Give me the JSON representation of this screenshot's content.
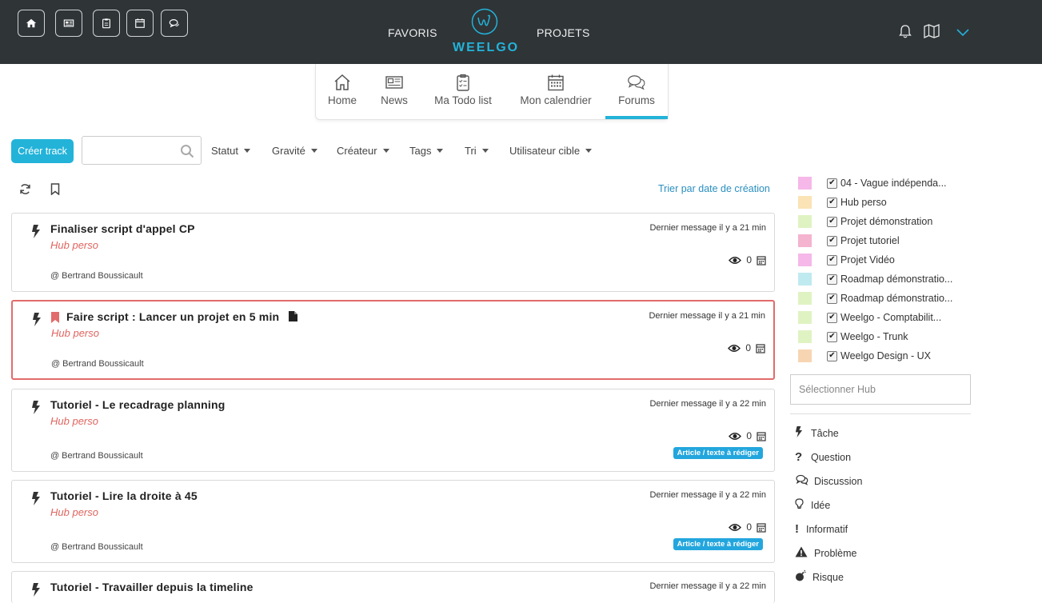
{
  "topbar": {
    "buttons": [
      "home",
      "news",
      "todo",
      "calendar",
      "chat"
    ],
    "favoris": "FAVORIS",
    "projets": "PROJETS",
    "logo": "WEELGO",
    "colors": {
      "bg": "#2f3437",
      "accent": "#23b3d9"
    }
  },
  "tabs": [
    {
      "label": "Home",
      "icon": "home-icon"
    },
    {
      "label": "News",
      "icon": "newspaper-icon"
    },
    {
      "label": "Ma Todo list",
      "icon": "checklist-icon"
    },
    {
      "label": "Mon calendrier",
      "icon": "calendar-icon"
    },
    {
      "label": "Forums",
      "icon": "comments-icon",
      "active": true
    }
  ],
  "filters": {
    "create_label": "Créer track",
    "search_value": "",
    "dropdowns": [
      "Statut",
      "Gravité",
      "Créateur",
      "Tags",
      "Tri",
      "Utilisateur cible"
    ],
    "sort_link": "Trier par date de création"
  },
  "tracks": [
    {
      "title": "Finaliser script d'appel CP",
      "hub": "Hub perso",
      "author": "Bertrand Boussicault",
      "last": "Dernier message il y a 21 min",
      "views": "0",
      "badge": ""
    },
    {
      "title": "Faire script : Lancer un projet en 5 min",
      "hub": "Hub perso",
      "author": "Bertrand Boussicault",
      "last": "Dernier message il y a 21 min",
      "views": "0",
      "badge": "",
      "bookmarked": true,
      "has_file": true
    },
    {
      "title": "Tutoriel - Le recadrage planning",
      "hub": "Hub perso",
      "author": "Bertrand Boussicault",
      "last": "Dernier message il y a 22 min",
      "views": "0",
      "badge": "Article / texte à rédiger"
    },
    {
      "title": "Tutoriel - Lire la droite à 45",
      "hub": "Hub perso",
      "author": "Bertrand Boussicault",
      "last": "Dernier message il y a 22 min",
      "views": "0",
      "badge": "Article / texte à rédiger"
    },
    {
      "title": "Tutoriel - Travailler depuis la timeline",
      "hub": "",
      "author": "",
      "last": "Dernier message il y a 22 min",
      "views": "",
      "badge": ""
    }
  ],
  "hubs": [
    {
      "label": "04 - Vague indépenda...",
      "color": "#f5b8e8"
    },
    {
      "label": "Hub perso",
      "color": "#fbe3b5"
    },
    {
      "label": "Projet démonstration",
      "color": "#dff3c2"
    },
    {
      "label": "Projet tutoriel",
      "color": "#f4b3cf"
    },
    {
      "label": "Projet Vidéo",
      "color": "#f5b8e8"
    },
    {
      "label": "Roadmap démonstratio...",
      "color": "#bfeaf0"
    },
    {
      "label": "Roadmap démonstratio...",
      "color": "#dff3c2"
    },
    {
      "label": "Weelgo - Comptabilit...",
      "color": "#dff3c2"
    },
    {
      "label": "Weelgo - Trunk",
      "color": "#dff3c2"
    },
    {
      "label": "Weelgo Design - UX",
      "color": "#f7d5b2"
    }
  ],
  "hub_select_placeholder": "Sélectionner Hub",
  "types": [
    {
      "label": "Tâche",
      "icon": "bolt-icon"
    },
    {
      "label": "Question",
      "icon": "question-icon"
    },
    {
      "label": "Discussion",
      "icon": "comments-icon"
    },
    {
      "label": "Idée",
      "icon": "lightbulb-icon"
    },
    {
      "label": "Informatif",
      "icon": "exclamation-icon"
    },
    {
      "label": "Problème",
      "icon": "warning-icon"
    },
    {
      "label": "Risque",
      "icon": "bomb-icon"
    }
  ]
}
